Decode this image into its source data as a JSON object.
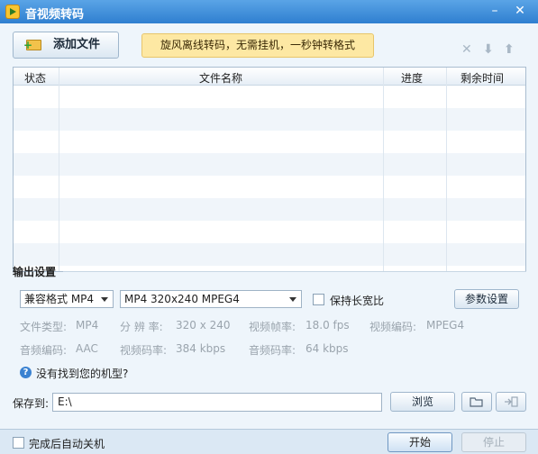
{
  "window": {
    "title": "音视频转码",
    "minimize_glyph": "–",
    "close_glyph": "✕"
  },
  "toolbar": {
    "add_file_label": "添加文件",
    "banner_text": "旋风离线转码，无需挂机，一秒钟转格式",
    "remove_glyph": "✕",
    "down_glyph": "⬇",
    "up_glyph": "⬆"
  },
  "file_table": {
    "columns": [
      "状态",
      "文件名称",
      "进度",
      "剩余时间"
    ],
    "rows": []
  },
  "output": {
    "section_title": "输出设置",
    "format_value": "兼容格式 MP4",
    "preset_value": "MP4 320x240 MPEG4",
    "keep_ratio_label": "保持长宽比",
    "params_button_label": "参数设置",
    "info": {
      "file_type_label": "文件类型:",
      "file_type_value": "MP4",
      "resolution_label": "分 辨 率:",
      "resolution_value": "320 x 240",
      "fps_label": "视频帧率:",
      "fps_value": "18.0 fps",
      "vcodec_label": "视频编码:",
      "vcodec_value": "MPEG4",
      "acodec_label": "音频编码:",
      "acodec_value": "AAC",
      "vbitrate_label": "视频码率:",
      "vbitrate_value": "384 kbps",
      "abitrate_label": "音频码率:",
      "abitrate_value": "64 kbps"
    },
    "help_link": "没有找到您的机型?"
  },
  "save": {
    "label": "保存到:",
    "path_value": "E:\\",
    "browse_label": "浏览"
  },
  "footer": {
    "auto_shutdown_label": "完成后自动关机",
    "start_label": "开始",
    "stop_label": "停止"
  }
}
